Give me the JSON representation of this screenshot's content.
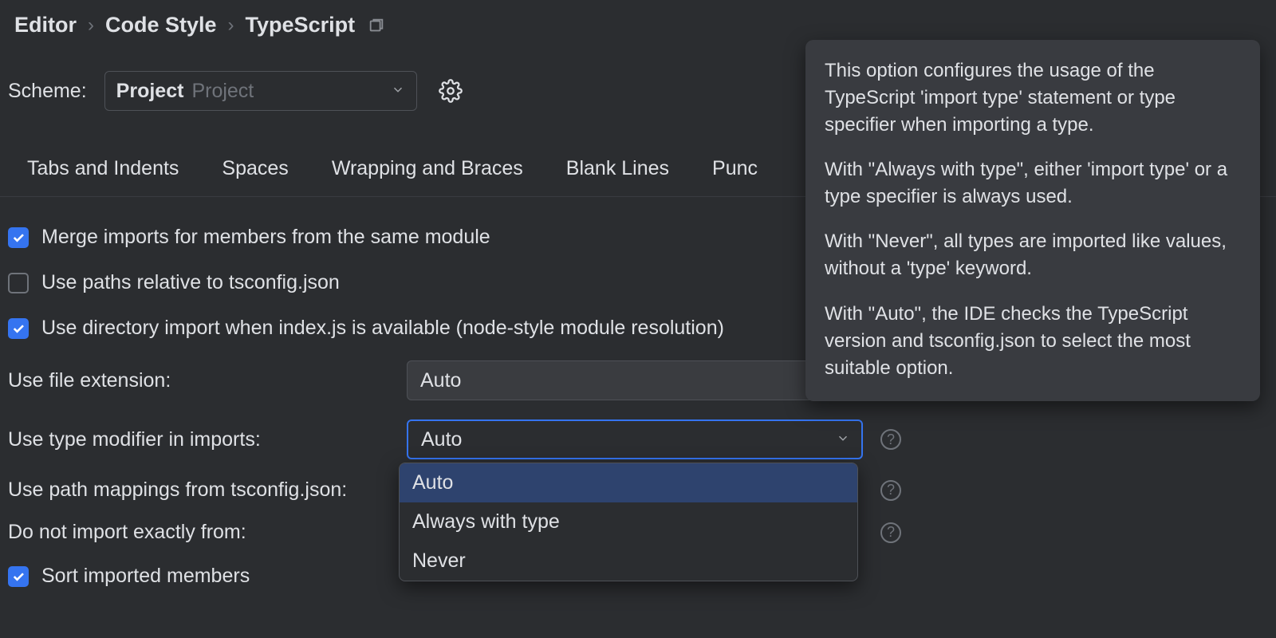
{
  "breadcrumb": {
    "items": [
      "Editor",
      "Code Style",
      "TypeScript"
    ]
  },
  "scheme": {
    "label": "Scheme:",
    "value": "Project",
    "secondary": "Project"
  },
  "tabs": [
    "Tabs and Indents",
    "Spaces",
    "Wrapping and Braces",
    "Blank Lines",
    "Punc"
  ],
  "checks": {
    "merge_imports": "Merge imports for members from the same module",
    "relative_paths": "Use paths relative to tsconfig.json",
    "directory_import": "Use directory import when index.js is available (node-style module resolution)",
    "sort_members": "Sort imported members"
  },
  "fields": {
    "file_extension": {
      "label": "Use file extension:",
      "value": "Auto"
    },
    "type_modifier": {
      "label": "Use type modifier in imports:",
      "value": "Auto"
    },
    "path_mappings": {
      "label": "Use path mappings from tsconfig.json:"
    },
    "do_not_import": {
      "label": "Do not import exactly from:"
    }
  },
  "dropdown": {
    "options": [
      "Auto",
      "Always with type",
      "Never"
    ]
  },
  "tooltip": {
    "p1": "This option configures the usage of the TypeScript 'import type' statement or type specifier when importing a type.",
    "p2": "With \"Always with type\", either 'import type' or a type specifier is always used.",
    "p3": "With \"Never\", all types are imported like values, without a 'type' keyword.",
    "p4": "With \"Auto\", the IDE checks the TypeScript version and tsconfig.json to select the most suitable option."
  }
}
